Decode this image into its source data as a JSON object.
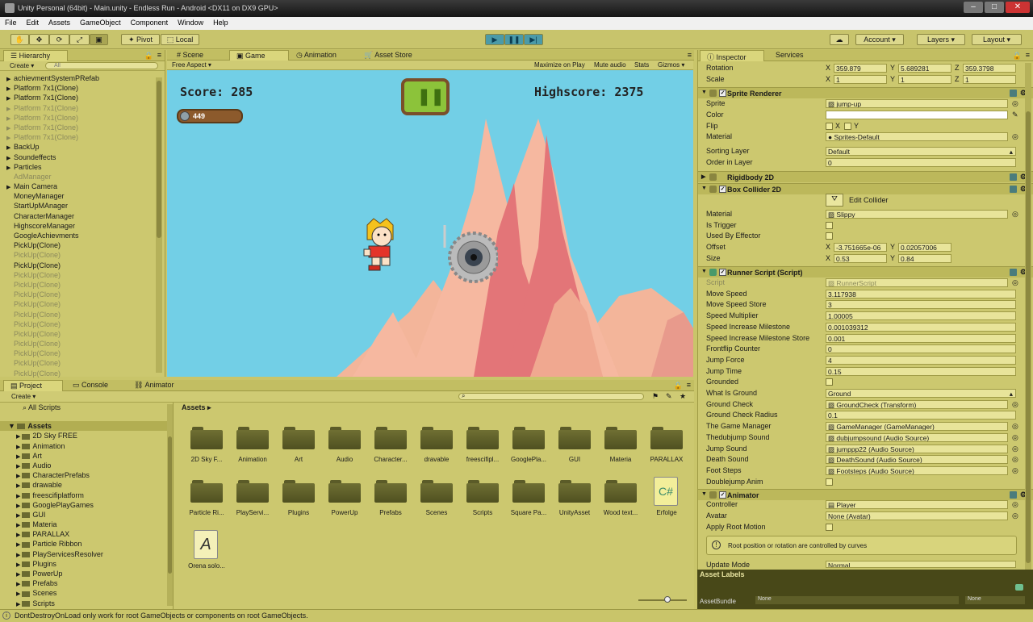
{
  "window": {
    "title": "Unity Personal (64bit) - Main.unity - Endless Run - Android <DX11 on DX9 GPU>"
  },
  "menu": [
    "File",
    "Edit",
    "Assets",
    "GameObject",
    "Component",
    "Window",
    "Help"
  ],
  "toolbar": {
    "pivot": "Pivot",
    "local": "Local",
    "account": "Account",
    "layers": "Layers",
    "layout": "Layout"
  },
  "hierarchy": {
    "tab": "Hierarchy",
    "create": "Create",
    "search_placeholder": "All",
    "items": [
      {
        "label": "achievmentSystemPRefab",
        "arrow": "▶",
        "dim": false
      },
      {
        "label": "Platform 7x1(Clone)",
        "arrow": "▶",
        "dim": false
      },
      {
        "label": "Platform 7x1(Clone)",
        "arrow": "▶",
        "dim": false
      },
      {
        "label": "Platform 7x1(Clone)",
        "arrow": "▶",
        "dim": true
      },
      {
        "label": "Platform 7x1(Clone)",
        "arrow": "▶",
        "dim": true
      },
      {
        "label": "Platform 7x1(Clone)",
        "arrow": "▶",
        "dim": true
      },
      {
        "label": "Platform 7x1(Clone)",
        "arrow": "▶",
        "dim": true
      },
      {
        "label": "BackUp",
        "arrow": "▶",
        "dim": false
      },
      {
        "label": "Soundeffects",
        "arrow": "▶",
        "dim": false
      },
      {
        "label": "Particles",
        "arrow": "▶",
        "dim": false
      },
      {
        "label": "AdManager",
        "arrow": "",
        "dim": true
      },
      {
        "label": "Main Camera",
        "arrow": "▶",
        "dim": false
      },
      {
        "label": "MoneyManager",
        "arrow": "",
        "dim": false
      },
      {
        "label": "StartUpMAnager",
        "arrow": "",
        "dim": false
      },
      {
        "label": "CharacterManager",
        "arrow": "",
        "dim": false
      },
      {
        "label": "HighscoreManager",
        "arrow": "",
        "dim": false
      },
      {
        "label": "GoogleAchievments",
        "arrow": "",
        "dim": false
      },
      {
        "label": "PickUp(Clone)",
        "arrow": "",
        "dim": false
      },
      {
        "label": "PickUp(Clone)",
        "arrow": "",
        "dim": true
      },
      {
        "label": "PickUp(Clone)",
        "arrow": "",
        "dim": false
      },
      {
        "label": "PickUp(Clone)",
        "arrow": "",
        "dim": true
      },
      {
        "label": "PickUp(Clone)",
        "arrow": "",
        "dim": true
      },
      {
        "label": "PickUp(Clone)",
        "arrow": "",
        "dim": true
      },
      {
        "label": "PickUp(Clone)",
        "arrow": "",
        "dim": true
      },
      {
        "label": "PickUp(Clone)",
        "arrow": "",
        "dim": true
      },
      {
        "label": "PickUp(Clone)",
        "arrow": "",
        "dim": true
      },
      {
        "label": "PickUp(Clone)",
        "arrow": "",
        "dim": true
      },
      {
        "label": "PickUp(Clone)",
        "arrow": "",
        "dim": true
      },
      {
        "label": "PickUp(Clone)",
        "arrow": "",
        "dim": true
      },
      {
        "label": "PickUp(Clone)",
        "arrow": "",
        "dim": true
      },
      {
        "label": "PickUp(Clone)",
        "arrow": "",
        "dim": true
      }
    ]
  },
  "center_tabs": [
    "Scene",
    "Game",
    "Animation",
    "Asset Store"
  ],
  "gamebar": {
    "aspect": "Free Aspect",
    "maximize": "Maximize on Play",
    "mute": "Mute audio",
    "stats": "Stats",
    "gizmos": "Gizmos"
  },
  "game": {
    "score": "Score: 285",
    "highscore": "Highscore: 2375",
    "coins": "449"
  },
  "inspector": {
    "tabs": [
      "Inspector",
      "Services"
    ],
    "rotation": {
      "label": "Rotation",
      "x": "359.879",
      "y": "5.689281",
      "z": "359.3798"
    },
    "scale": {
      "label": "Scale",
      "x": "1",
      "y": "1",
      "z": "1"
    },
    "sprite_renderer": {
      "title": "Sprite Renderer",
      "sprite_label": "Sprite",
      "sprite": "jump-up",
      "color_label": "Color",
      "flip_label": "Flip",
      "flip_x": "X",
      "flip_y": "Y",
      "material_label": "Material",
      "material": "Sprites-Default",
      "sorting_layer_label": "Sorting Layer",
      "sorting_layer": "Default",
      "order_label": "Order in Layer",
      "order": "0"
    },
    "rigidbody": {
      "title": "Rigidbody 2D"
    },
    "box_collider": {
      "title": "Box Collider 2D",
      "edit": "Edit Collider",
      "material_label": "Material",
      "material": "Slippy",
      "is_trigger": "Is Trigger",
      "used_by_effector": "Used By Effector",
      "offset_label": "Offset",
      "offset_x": "-3.751665e-06",
      "offset_y": "0.02057006",
      "size_label": "Size",
      "size_x": "0.53",
      "size_y": "0.84"
    },
    "runner": {
      "title": "Runner Script (Script)",
      "fields": [
        {
          "label": "Script",
          "value": "RunnerScript",
          "dim": true
        },
        {
          "label": "Move Speed",
          "value": "3.117938"
        },
        {
          "label": "Move Speed Store",
          "value": "3"
        },
        {
          "label": "Speed Multiplier",
          "value": "1.00005"
        },
        {
          "label": "Speed Increase Milestone",
          "value": "0.001039312"
        },
        {
          "label": "Speed Increase Milestone Store",
          "value": "0.001"
        },
        {
          "label": "Frontflip Counter",
          "value": "0"
        },
        {
          "label": "Jump Force",
          "value": "4"
        },
        {
          "label": "Jump Time",
          "value": "0.15"
        },
        {
          "label": "Grounded",
          "check": true
        },
        {
          "label": "What Is Ground",
          "value": "Ground",
          "dropdown": true
        },
        {
          "label": "Ground Check",
          "value": "GroundCheck (Transform)",
          "ref": true
        },
        {
          "label": "Ground Check Radius",
          "value": "0.1"
        },
        {
          "label": "The Game Manager",
          "value": "GameManager (GameManager)",
          "ref": true
        },
        {
          "label": "Thedubjump Sound",
          "value": "dubjumpsound (Audio Source)",
          "ref": true
        },
        {
          "label": "Jump Sound",
          "value": "jumppp22 (Audio Source)",
          "ref": true
        },
        {
          "label": "Death Sound",
          "value": "DeathSound (Audio Source)",
          "ref": true
        },
        {
          "label": "Foot Steps",
          "value": "Footsteps (Audio Source)",
          "ref": true
        },
        {
          "label": "Doublejump Anim",
          "check": true
        }
      ]
    },
    "animator": {
      "title": "Animator",
      "controller_label": "Controller",
      "controller": "Player",
      "avatar_label": "Avatar",
      "avatar": "None (Avatar)",
      "apply_root_label": "Apply Root Motion",
      "info": "Root position or rotation are controlled by curves",
      "update_mode_label": "Update Mode",
      "update_mode": "Normal"
    },
    "asset_labels": "Asset Labels",
    "asset_bundle": "AssetBundle",
    "bundle_none1": "None",
    "bundle_none2": "None"
  },
  "project": {
    "tabs": [
      "Project",
      "Console",
      "Animator"
    ],
    "create": "Create",
    "all_scripts": "All Scripts",
    "tree_root": "Assets",
    "tree": [
      "2D Sky FREE",
      "Animation",
      "Art",
      "Audio",
      "CharacterPrefabs",
      "drawable",
      "freescifiplatform",
      "GooglePlayGames",
      "GUI",
      "Materia",
      "PARALLAX",
      "Particle Ribbon",
      "PlayServicesResolver",
      "Plugins",
      "PowerUp",
      "Prefabs",
      "Scenes",
      "Scripts"
    ],
    "breadcrumb": "Assets",
    "grid_row1": [
      "2D Sky F...",
      "Animation",
      "Art",
      "Audio",
      "Character...",
      "dravable",
      "freescifipl...",
      "GooglePla...",
      "GUI",
      "Materia",
      "PARALLAX"
    ],
    "grid_row2": [
      "Particle Ri...",
      "PlayServi...",
      "Plugins",
      "PowerUp",
      "Prefabs",
      "Scenes",
      "Scripts",
      "Square Pa...",
      "UnityAsset",
      "Wood text...",
      "Erfolge"
    ],
    "grid_row3": [
      "Orena solo..."
    ],
    "cs_glyph": "C#",
    "font_glyph": "A"
  },
  "status": "DontDestroyOnLoad only work for root GameObjects or components on root GameObjects."
}
